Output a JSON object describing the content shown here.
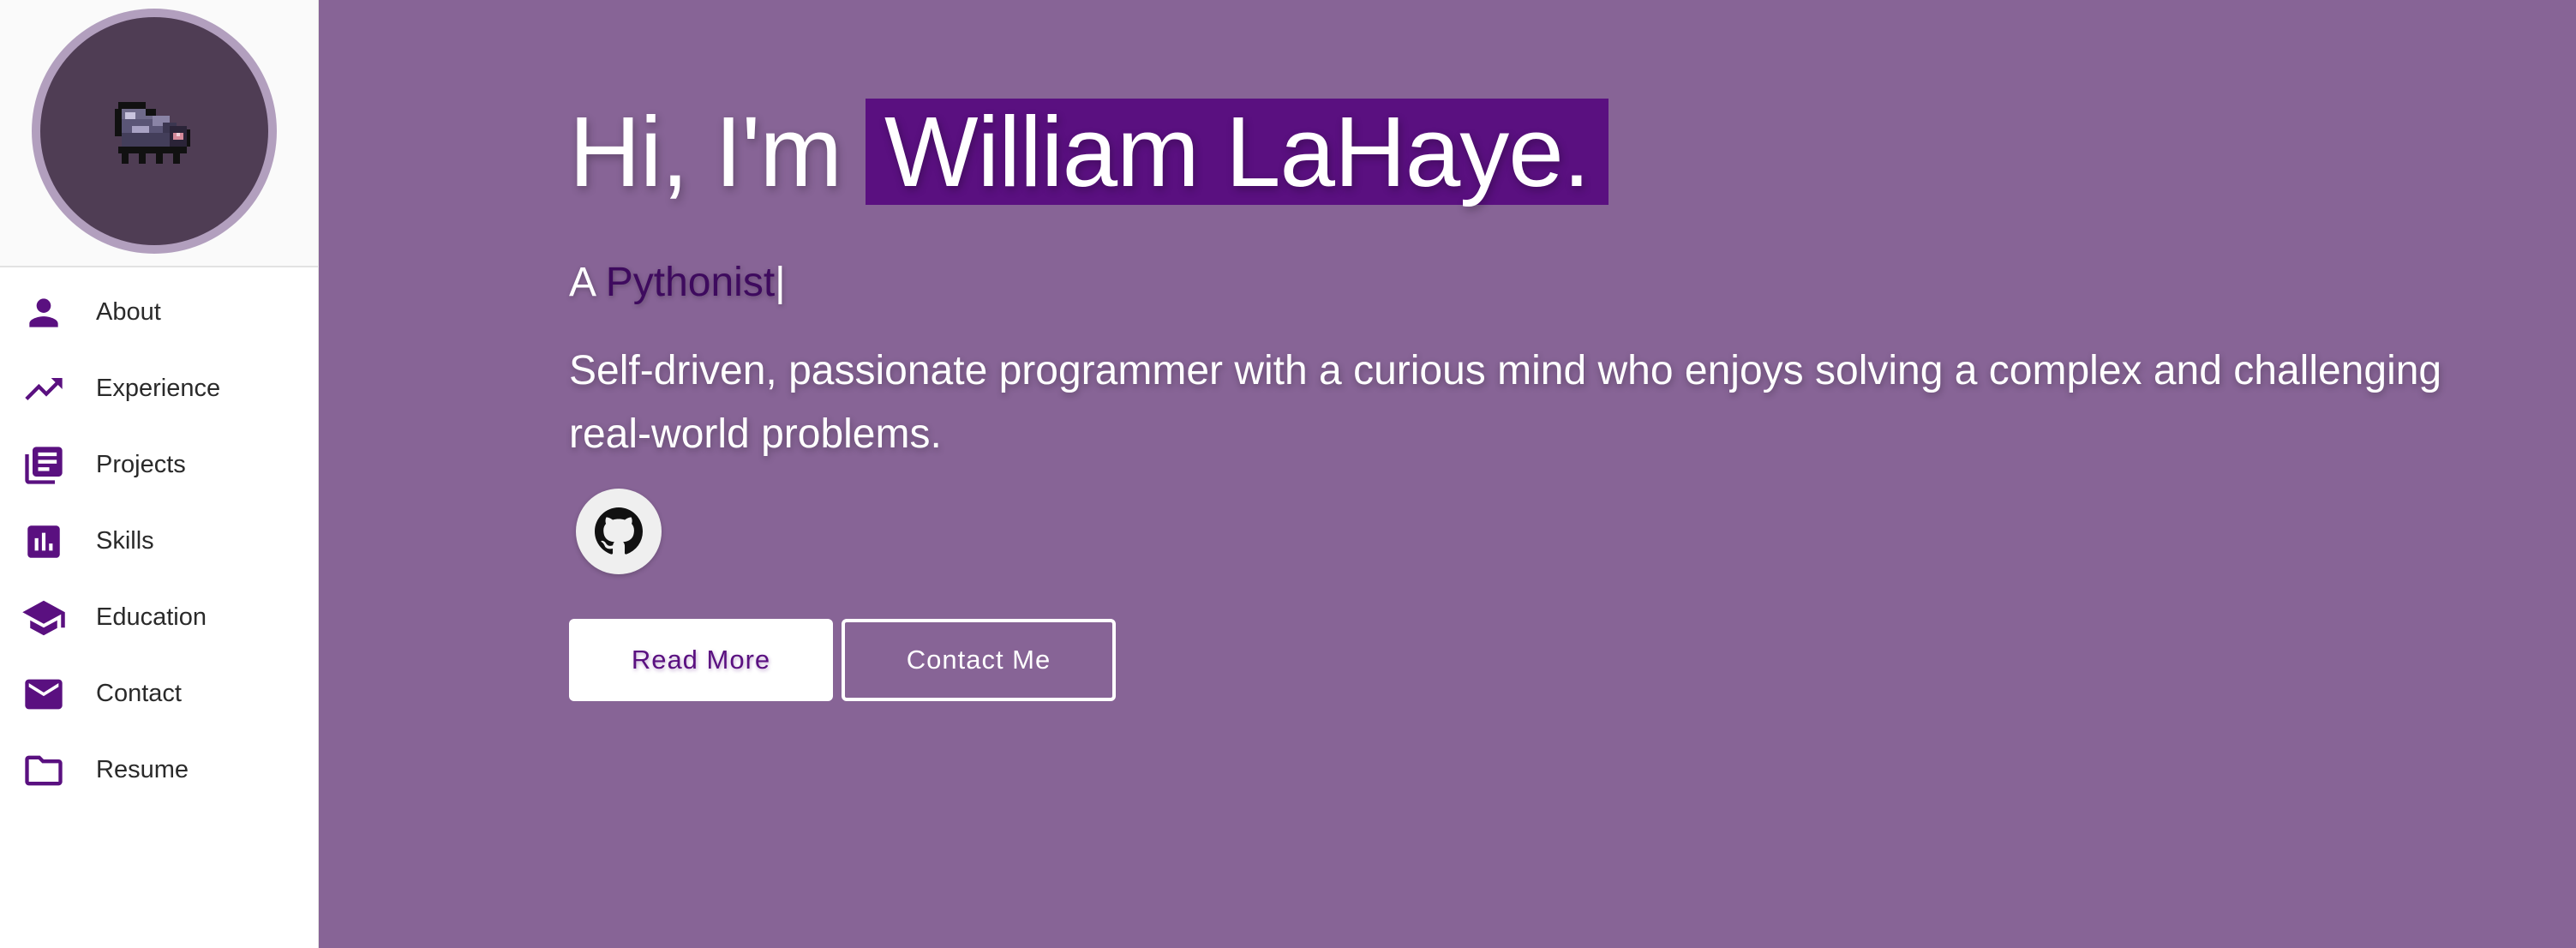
{
  "colors": {
    "background": "#876496",
    "accent": "#5a1080",
    "sidebar_icon": "#5a1080",
    "role_text": "#3e0a5e"
  },
  "sidebar": {
    "avatar": {
      "icon": "pixel-creature-icon"
    },
    "items": [
      {
        "label": "About",
        "icon": "person-icon"
      },
      {
        "label": "Experience",
        "icon": "trending-up-icon"
      },
      {
        "label": "Projects",
        "icon": "library-books-icon"
      },
      {
        "label": "Skills",
        "icon": "bar-chart-icon"
      },
      {
        "label": "Education",
        "icon": "graduation-cap-icon"
      },
      {
        "label": "Contact",
        "icon": "mail-icon"
      },
      {
        "label": "Resume",
        "icon": "folder-icon"
      }
    ]
  },
  "hero": {
    "greeting": "Hi, I'm",
    "name": "William LaHaye.",
    "tagline_prefix": "A",
    "tagline_role": "Pythonist",
    "cursor": "|",
    "bio": "Self-driven, passionate programmer with a curious mind who enjoys solving a complex and challenging real-world problems.",
    "social": {
      "icon": "github-icon"
    },
    "buttons": {
      "read_more": "Read More",
      "contact_me": "Contact Me"
    }
  }
}
